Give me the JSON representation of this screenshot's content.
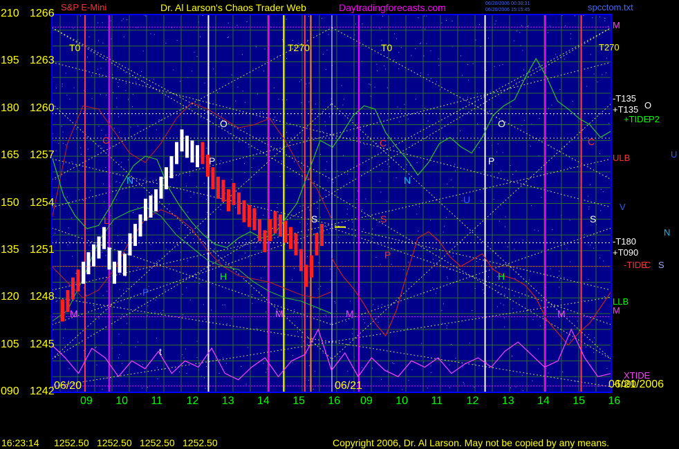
{
  "header": {
    "instrument": "S&P E-Mini",
    "title": "Dr. Al Larson's Chaos Trader Web",
    "site": "Daytradingforecasts.com",
    "stamp1": "06/20/2006 00:30:31",
    "stamp2": "06/20/2006 15:15:45",
    "file": "spcctom.txt"
  },
  "footer": {
    "time": "16:23:14",
    "o": "1252.50",
    "h": "1252.50",
    "l": "1252.50",
    "c": "1252.50",
    "copyright": "Copyright 2006, Dr. Al Larson. May not be copied by any means."
  },
  "colors": {
    "bg": "#000000",
    "plot_bg": "#00008b",
    "border": "#0000ff",
    "price": "#ffff00",
    "time": "#00ff00"
  },
  "chart_data": {
    "type": "line",
    "title": "Dr. Al Larson's Chaos Trader Web",
    "y_left_labels": [
      "210",
      "195",
      "180",
      "165",
      "150",
      "135",
      "120",
      "105",
      "090"
    ],
    "y_price_labels": [
      "1266",
      "1263",
      "1260",
      "1257",
      "1254",
      "1251",
      "1248",
      "1245",
      "1242"
    ],
    "ylim": [
      1242,
      1266
    ],
    "x_labels_day1": [
      "09",
      "10",
      "11",
      "12",
      "13",
      "14",
      "15",
      "16"
    ],
    "x_labels_day2": [
      "09",
      "10",
      "11",
      "12",
      "13",
      "14",
      "15",
      "16"
    ],
    "dates": [
      "06/20",
      "06/21",
      "06/21/2006"
    ],
    "right_labels": [
      "M",
      "T270",
      "-T135",
      "+T135",
      "+TIDE",
      "P2",
      "O",
      "U",
      "ULB",
      "V",
      "N",
      "-T180",
      "+T090",
      "-TIDE",
      "C",
      "S",
      "LLB",
      "M",
      "XTIDE",
      "-T090"
    ],
    "chart_letters_day1": [
      "T0",
      "T270",
      "C",
      "O",
      "N",
      "P",
      "S",
      "L",
      "H",
      "P",
      "M",
      "M",
      "t"
    ],
    "chart_letters_day2": [
      "T0",
      "C",
      "N",
      "O",
      "P",
      "S",
      "U",
      "H",
      "M",
      "M",
      "P"
    ],
    "series": [
      {
        "name": "price_0620",
        "values": [
          1247.2,
          1247.8,
          1248.6,
          1249.1,
          1249.6,
          1250.2,
          1250.7,
          1251.2,
          1251.8,
          1250.5,
          1249.6,
          1250.3,
          1250.1,
          1251.4,
          1252.0,
          1252.6,
          1253.6,
          1253.8,
          1254.2,
          1255.0,
          1255.6,
          1256.3,
          1257.2,
          1258.0,
          1257.6,
          1257.3,
          1257.0,
          1257.2,
          1256.4,
          1255.6,
          1255.0,
          1254.8,
          1254.2,
          1254.6,
          1254.0,
          1253.5,
          1253.2,
          1253.0,
          1252.3,
          1251.6,
          1252.3,
          1252.8,
          1252.6,
          1252.2,
          1251.8,
          1251.4,
          1250.4,
          1249.4,
          1250.0,
          1251.4,
          1252.0
        ],
        "colors": [
          0,
          0,
          0,
          0,
          1,
          1,
          1,
          1,
          1,
          1,
          1,
          1,
          1,
          1,
          1,
          1,
          1,
          1,
          1,
          1,
          1,
          1,
          1,
          1,
          1,
          1,
          1,
          0,
          0,
          0,
          0,
          0,
          0,
          0,
          0,
          0,
          0,
          0,
          0,
          0,
          0,
          0,
          0,
          0,
          0,
          0,
          0,
          0,
          0,
          0,
          0
        ]
      },
      {
        "name": "green_day1",
        "values": [
          1257.0,
          1254.5,
          1253.2,
          1252.4,
          1252.6,
          1253.8,
          1255.2,
          1256.4,
          1257.0,
          1256.8,
          1255.0,
          1253.8,
          1252.8,
          1252.0,
          1251.4,
          1251.2,
          1251.8,
          1252.2,
          1251.8,
          1252.0,
          1253.0,
          1254.0,
          1256.0,
          1258.0,
          1257.6
        ]
      },
      {
        "name": "green_day2",
        "values": [
          1257.5,
          1258.5,
          1259.6,
          1260.2,
          1260.0,
          1258.5,
          1257.6,
          1256.8,
          1255.8,
          1256.6,
          1257.8,
          1258.2,
          1257.6,
          1257.2,
          1258.2,
          1259.6,
          1260.2,
          1260.6,
          1262.0,
          1263.2,
          1262.0,
          1260.5,
          1260.0,
          1259.4,
          1259.0,
          1258.2,
          1258.6
        ]
      },
      {
        "name": "red_day2",
        "values": [
          1250.5,
          1249.4,
          1248.6,
          1247.6,
          1246.4,
          1245.6,
          1247.2,
          1249.6,
          1251.8,
          1252.2,
          1251.6,
          1250.6,
          1250.0,
          1250.4,
          1250.8,
          1249.8,
          1249.4,
          1249.2,
          1248.8,
          1248.0,
          1246.6,
          1245.8,
          1245.0,
          1245.8,
          1246.4,
          1247.4,
          1248.4
        ]
      },
      {
        "name": "xtide",
        "values": [
          1245.0,
          1244.2,
          1243.2,
          1244.8,
          1244.2,
          1243.0,
          1244.0,
          1243.5,
          1244.6,
          1243.2,
          1244.0,
          1243.6,
          1244.8,
          1243.2,
          1242.8,
          1243.6,
          1244.2,
          1243.0,
          1244.0,
          1244.4,
          1246.0,
          1243.4,
          1244.5,
          1243.0,
          1244.2,
          1243.4,
          1243.0,
          1244.0,
          1243.6,
          1244.2,
          1243.2,
          1243.8,
          1244.2,
          1243.6,
          1244.6,
          1245.2,
          1244.4,
          1243.6,
          1244.0,
          1246.0,
          1244.2,
          1243.0,
          1243.2
        ]
      }
    ],
    "vertical_lines": [
      {
        "x": "09:25",
        "color": "#ff4040"
      },
      {
        "x": "10:05",
        "color": "#ff00ff"
      },
      {
        "x": "12:50",
        "color": "#ffffff"
      },
      {
        "x": "14:30",
        "color": "#ff00ff"
      },
      {
        "x": "14:55",
        "color": "#ffff00"
      },
      {
        "x": "15:30",
        "color": "#ff4040"
      },
      {
        "x": "15:40",
        "color": "#ff8c00"
      },
      {
        "x": "21-09:15",
        "color": "#ff00ff"
      },
      {
        "x": "21-12:45",
        "color": "#ffffff"
      },
      {
        "x": "21-14:25",
        "color": "#ff00ff"
      },
      {
        "x": "21-15:25",
        "color": "#ff4040"
      }
    ],
    "grid": true
  }
}
